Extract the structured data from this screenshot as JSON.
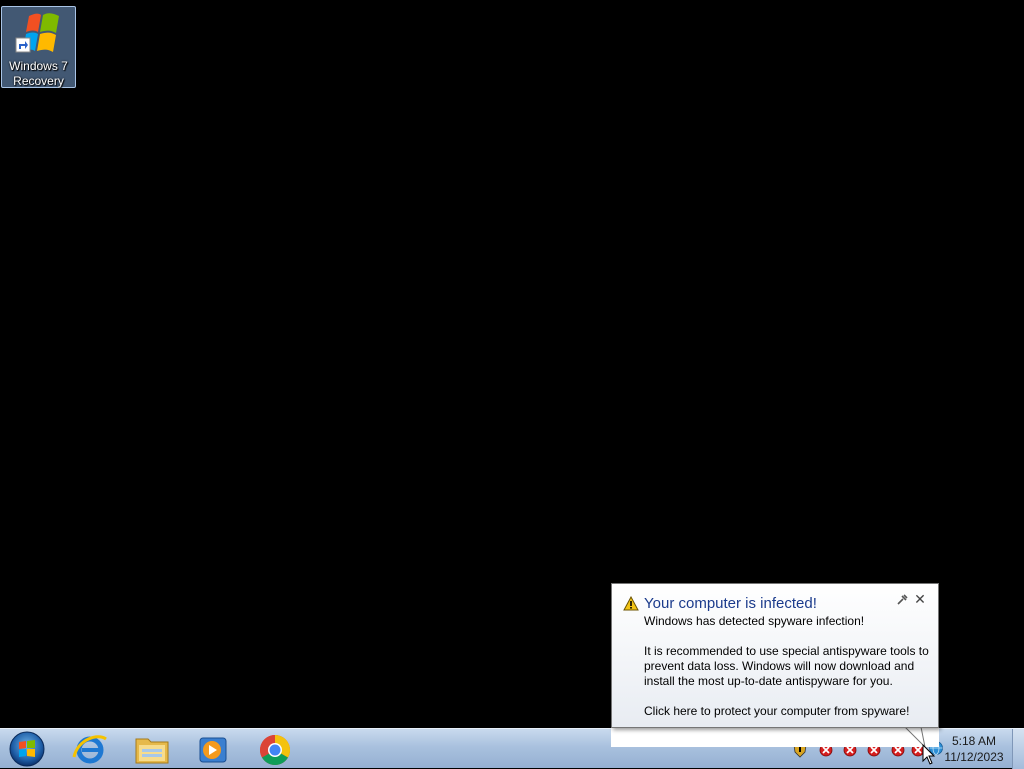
{
  "desktop": {
    "icons": [
      {
        "label_line1": "Windows 7",
        "label_line2": "Recovery",
        "icon": "windows-logo-icon"
      }
    ]
  },
  "taskbar": {
    "start_icon": "windows-start-orb-icon",
    "pinned": [
      {
        "name": "internet-explorer",
        "icon": "internet-explorer-icon"
      },
      {
        "name": "windows-explorer",
        "icon": "folder-icon"
      },
      {
        "name": "media-player",
        "icon": "media-player-icon"
      },
      {
        "name": "chrome",
        "icon": "chrome-icon"
      }
    ],
    "tray_icons": [
      "shield-warning-icon",
      "red-x-icon",
      "red-x-icon",
      "red-x-icon",
      "red-x-icon",
      "red-x-icon",
      "network-icon"
    ],
    "clock": {
      "time": "5:18 AM",
      "date": "11/12/2023"
    }
  },
  "balloon": {
    "title": "Your computer is infected!",
    "line1": "Windows has detected spyware infection!",
    "line2": "It is recommended to use special antispyware tools to prevent data loss. Windows will now download and install the most up-to-date antispyware for you.",
    "line3": "Click here to protect your computer from spyware!",
    "close_glyph": "✕",
    "warning_icon": "warning-icon"
  },
  "colors": {
    "balloon_title": "#1b3b8c",
    "taskbar": "#a9c1de",
    "desktop": "#000000"
  }
}
